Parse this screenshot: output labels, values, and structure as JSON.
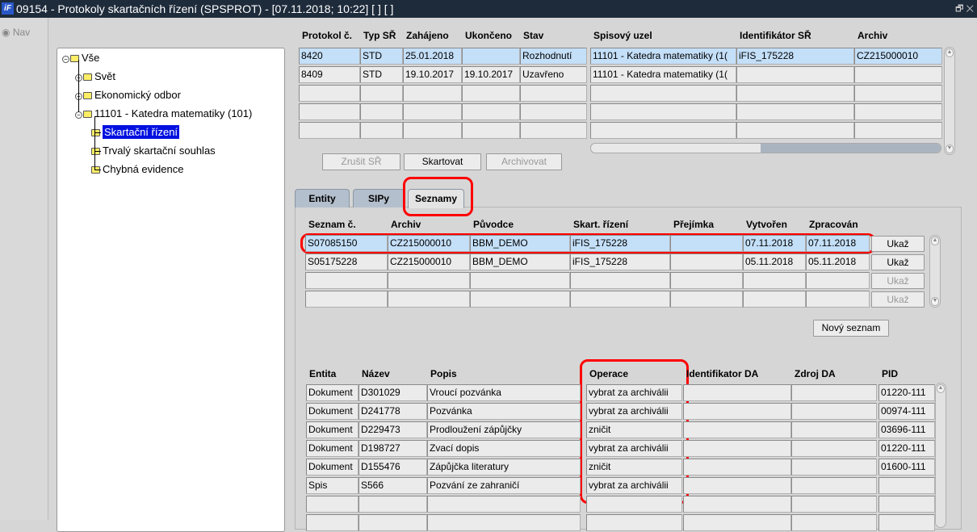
{
  "window": {
    "title": "09154 - Protokoly skartačních řízení (SPSPROT) - [07.11.2018; 10:22] [ ] [ ]",
    "logo": "iF",
    "controls": "🗗 ✕"
  },
  "nav": {
    "label": "Nav"
  },
  "tree": {
    "items": [
      {
        "label": "Vše",
        "expander": "−"
      },
      {
        "label": "Svět",
        "expander": "+"
      },
      {
        "label": "Ekonomický odbor",
        "expander": "+"
      },
      {
        "label": "11101 - Katedra matematiky (101)",
        "expander": "−"
      },
      {
        "label": "Skartační řízení",
        "selected": true
      },
      {
        "label": "Trvalý skartační souhlas"
      },
      {
        "label": "Chybná evidence"
      }
    ]
  },
  "protokoly": {
    "left_headers": [
      "Protokol č.",
      "Typ SŘ",
      "Zahájeno",
      "Ukončeno",
      "Stav"
    ],
    "right_headers": [
      "Spisový uzel",
      "Identifikátor SŘ",
      "Archiv"
    ],
    "rows": [
      [
        "8420",
        "STD",
        "25.01.2018",
        "",
        "Rozhodnutí",
        "11101 - Katedra matematiky (1(",
        "iFIS_175228",
        "CZ215000010"
      ],
      [
        "8409",
        "STD",
        "19.10.2017",
        "19.10.2017",
        "Uzavřeno",
        "11101 - Katedra matematiky (1(",
        "",
        ""
      ],
      [
        "",
        "",
        "",
        "",
        "",
        "",
        "",
        ""
      ],
      [
        "",
        "",
        "",
        "",
        "",
        "",
        "",
        ""
      ],
      [
        "",
        "",
        "",
        "",
        "",
        "",
        "",
        ""
      ]
    ],
    "buttons": {
      "zrusit": "Zrušit SŘ",
      "skartovat": "Skartovat",
      "archivovat": "Archivovat"
    }
  },
  "tabs": [
    {
      "label": "Entity"
    },
    {
      "label": "SIPy"
    },
    {
      "label": "Seznamy",
      "active": true
    }
  ],
  "seznamy": {
    "headers": [
      "Seznam č.",
      "Archiv",
      "Původce",
      "Skart. řízení",
      "Přejímka",
      "Vytvořen",
      "Zpracován"
    ],
    "rows": [
      [
        "S07085150",
        "CZ215000010",
        "BBM_DEMO",
        "iFIS_175228",
        "",
        "07.11.2018",
        "07.11.2018"
      ],
      [
        "S05175228",
        "CZ215000010",
        "BBM_DEMO",
        "iFIS_175228",
        "",
        "05.11.2018",
        "05.11.2018"
      ],
      [
        "",
        "",
        "",
        "",
        "",
        "",
        ""
      ],
      [
        "",
        "",
        "",
        "",
        "",
        "",
        ""
      ]
    ],
    "show_label": "Ukaž",
    "new_label": "Nový seznam"
  },
  "polozky": {
    "headers": [
      "Entita",
      "Název",
      "Popis",
      "Operace",
      "Identifikator DA",
      "Zdroj DA",
      "PID"
    ],
    "rows": [
      [
        "Dokument",
        "D301029",
        "Vroucí pozvánka",
        "vybrat za archiválii",
        "",
        "",
        "01220-111"
      ],
      [
        "Dokument",
        "D241778",
        "Pozvánka",
        "vybrat za archiválii",
        "",
        "",
        "00974-111"
      ],
      [
        "Dokument",
        "D229473",
        "Prodloužení zápůjčky",
        "zničit",
        "",
        "",
        "03696-111"
      ],
      [
        "Dokument",
        "D198727",
        "Zvací dopis",
        "vybrat za archiválii",
        "",
        "",
        "01220-111"
      ],
      [
        "Dokument",
        "D155476",
        "Zápůjčka literatury",
        "zničit",
        "",
        "",
        "01600-111"
      ],
      [
        "Spis",
        "S566",
        "Pozvání ze zahraničí",
        "vybrat za archiválii",
        "",
        "",
        " "
      ],
      [
        "",
        "",
        "",
        "",
        "",
        "",
        ""
      ],
      [
        "",
        "",
        "",
        "",
        "",
        "",
        ""
      ]
    ]
  }
}
